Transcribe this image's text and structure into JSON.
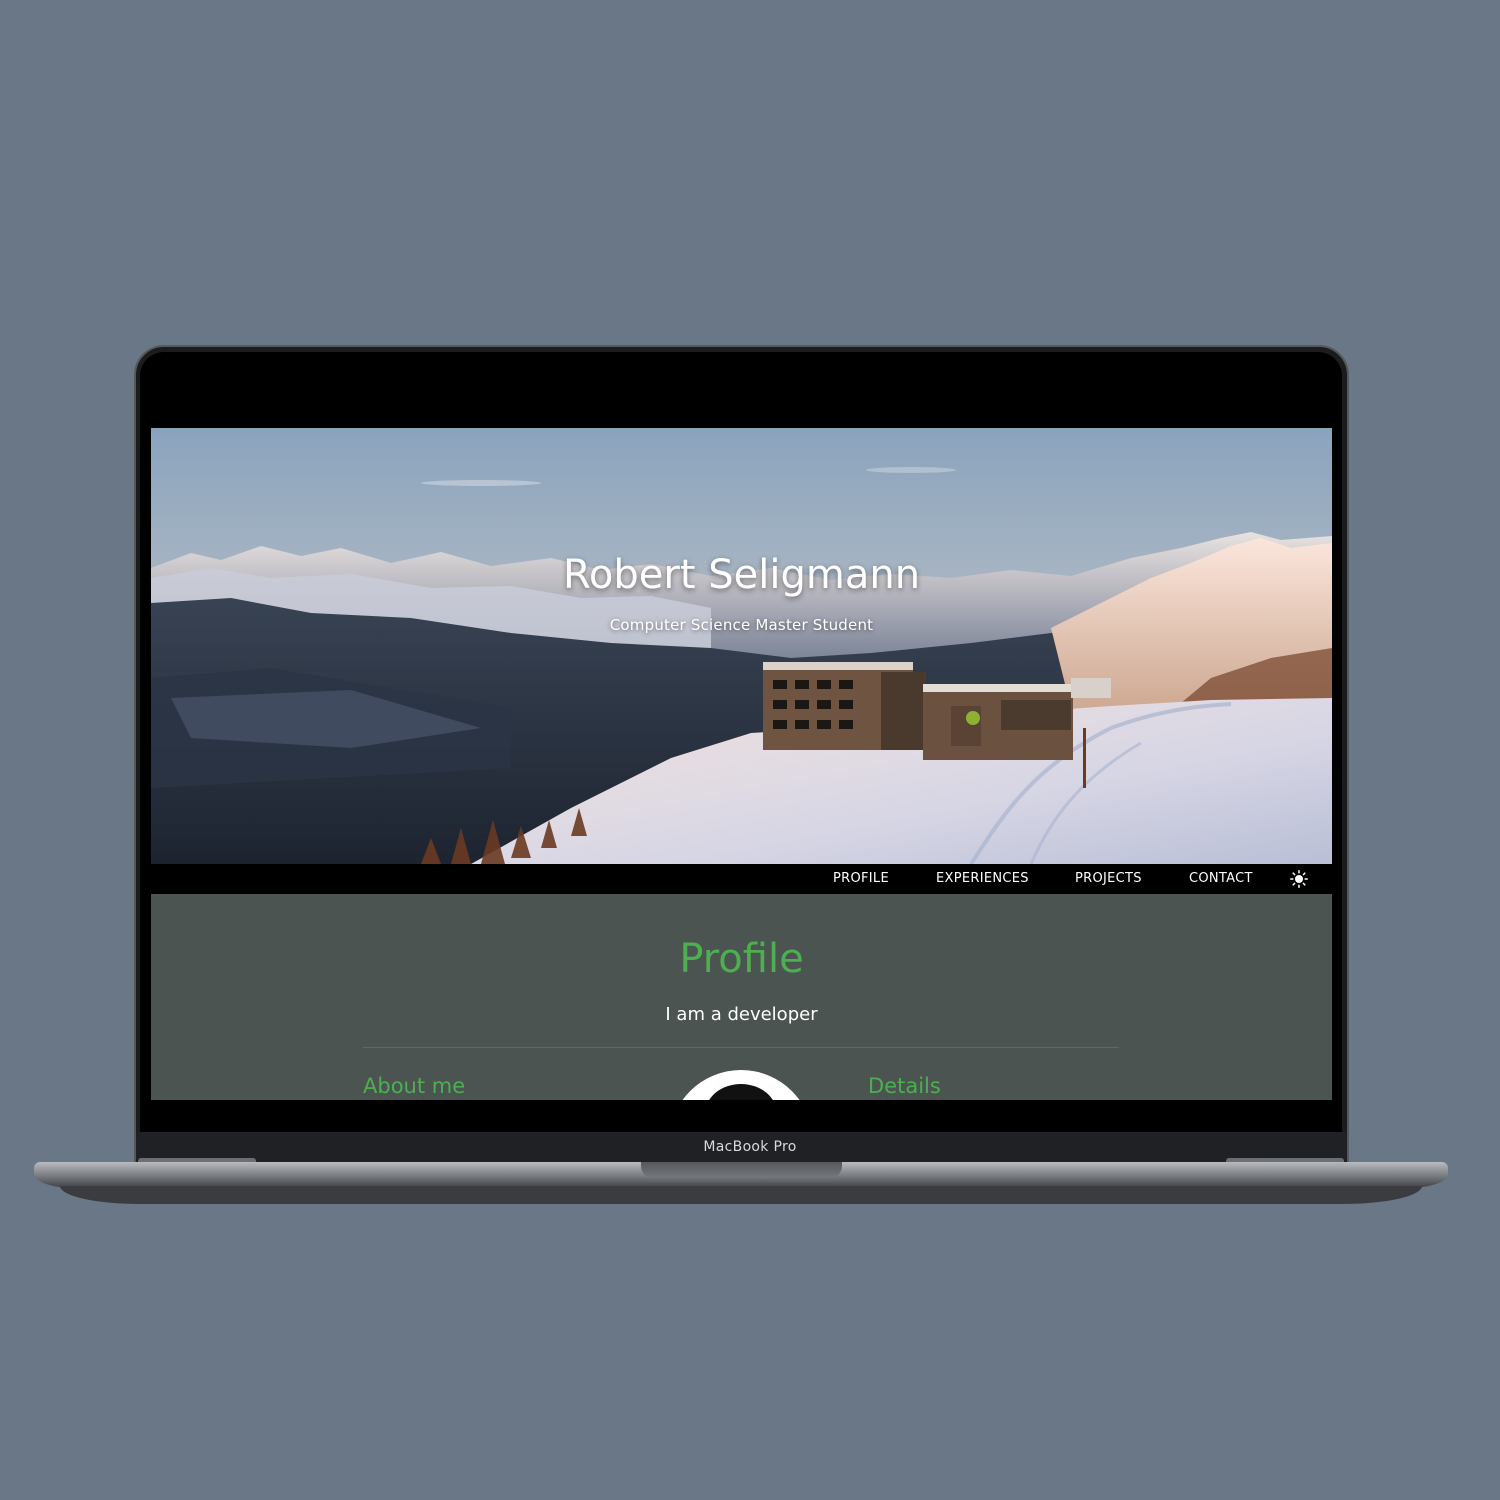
{
  "device": {
    "label": "MacBook Pro"
  },
  "hero": {
    "title": "Robert Seligmann",
    "subtitle": "Computer Science Master Student",
    "image": "snowy-mountain-hotel-landscape"
  },
  "nav": {
    "items": [
      {
        "label": "PROFILE"
      },
      {
        "label": "EXPERIENCES"
      },
      {
        "label": "PROJECTS"
      },
      {
        "label": "CONTACT"
      }
    ],
    "theme_toggle_icon": "sun-icon"
  },
  "profile": {
    "title": "Profile",
    "subtitle": "I am a developer",
    "about_heading": "About me",
    "details_heading": "Details"
  },
  "colors": {
    "background": "#697786",
    "accent_green": "#4caf50",
    "section_bg": "#4b5451",
    "navbar_bg": "#000000"
  }
}
